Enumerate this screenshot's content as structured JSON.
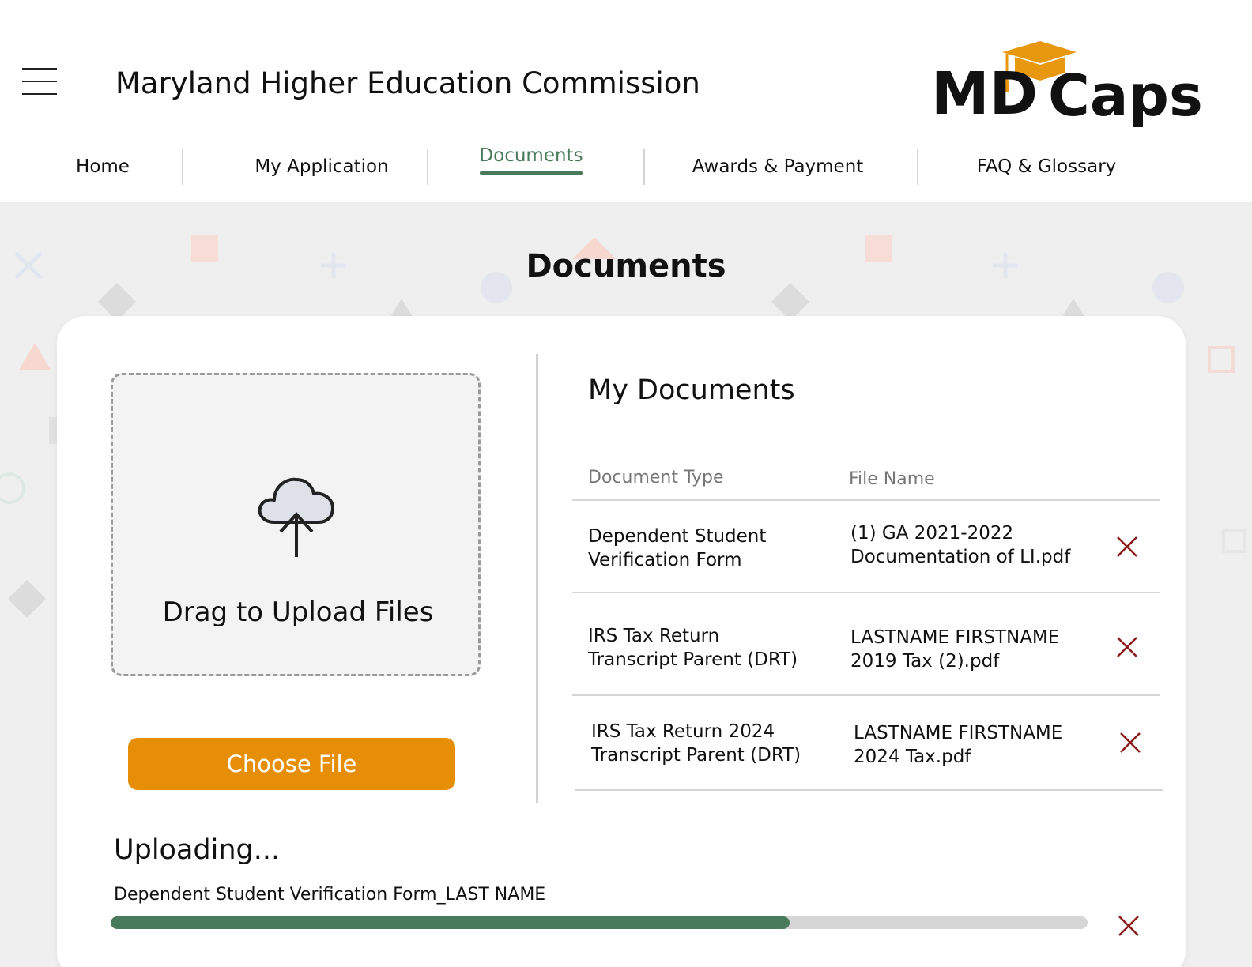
{
  "header": {
    "org_title": "Maryland Higher Education Commission",
    "logo_text_left": "MD",
    "logo_text_right": "Caps"
  },
  "nav": {
    "items": [
      {
        "label": "Home",
        "active": false
      },
      {
        "label": "My Application",
        "active": false
      },
      {
        "label": "Documents",
        "active": true
      },
      {
        "label": "Awards & Payment",
        "active": false
      },
      {
        "label": "FAQ & Glossary",
        "active": false
      }
    ]
  },
  "page": {
    "title": "Documents"
  },
  "upload_panel": {
    "drop_label": "Drag to Upload Files",
    "choose_label": "Choose File"
  },
  "my_documents": {
    "title": "My Documents",
    "columns": [
      "Document Type",
      "File Name"
    ],
    "rows": [
      {
        "type_line1": "Dependent Student",
        "type_line2": "Verification Form",
        "file_line1": "(1) GA 2021-2022",
        "file_line2": "Documentation of LI.pdf"
      },
      {
        "type_line1": "IRS Tax Return",
        "type_line2": "Transcript Parent (DRT)",
        "file_line1": "LASTNAME FIRSTNAME",
        "file_line2": "2019 Tax (2).pdf"
      },
      {
        "type_line1": "IRS Tax Return 2024",
        "type_line2": "Transcript Parent (DRT)",
        "file_line1": "LASTNAME FIRSTNAME",
        "file_line2": "2024 Tax.pdf"
      }
    ]
  },
  "uploading": {
    "title": "Uploading...",
    "file_name": "Dependent Student Verification Form_LAST NAME",
    "progress": 0.695
  },
  "colors": {
    "accent_green": "#4a7a5c",
    "accent_orange": "#e68e06",
    "delete_red": "#8b1a1a"
  },
  "icons": {
    "menu": "hamburger-icon",
    "upload": "cloud-upload-icon",
    "delete": "close-icon",
    "logo_cap": "graduation-cap-icon"
  }
}
